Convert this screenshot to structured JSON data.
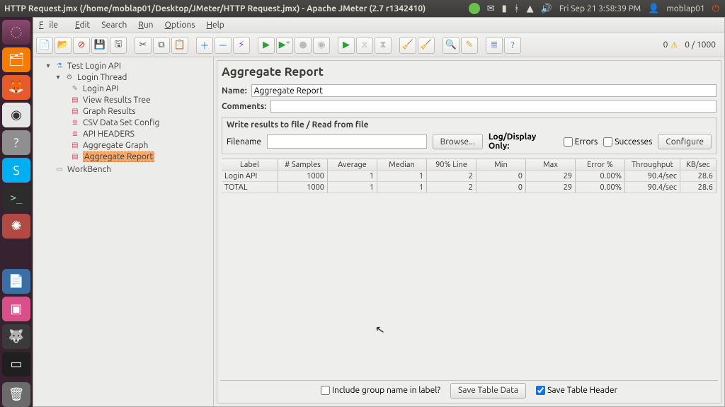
{
  "system": {
    "window_title": "HTTP Request.jmx (/home/moblap01/Desktop/JMeter/HTTP Request.jmx) - Apache JMeter (2.7 r1342410)",
    "clock": "Fri Sep 21 3:58:39 PM",
    "username": "moblap01"
  },
  "launcher": {
    "items": [
      "dash",
      "files",
      "firefox",
      "chrome",
      "help",
      "skype",
      "terminal",
      "settings",
      "writer",
      "media",
      "gimp",
      "screenshot"
    ],
    "trash": "trash"
  },
  "menubar": {
    "file": "File",
    "edit": "Edit",
    "search": "Search",
    "run": "Run",
    "options": "Options",
    "help": "Help"
  },
  "toolbar_counter": {
    "warn": "0",
    "threads": "0 / 1000"
  },
  "tree": {
    "root": "Test Login API",
    "thread": "Login Thread",
    "children": {
      "sampler": "Login API",
      "vtree": "View Results Tree",
      "graph": "Graph Results",
      "csv": "CSV Data Set Config",
      "headers": "API HEADERS",
      "agg_graph": "Aggregate Graph",
      "agg_report": "Aggregate Report"
    },
    "workbench": "WorkBench"
  },
  "panel": {
    "title": "Aggregate Report",
    "name_label": "Name:",
    "name_value": "Aggregate Report",
    "comments_label": "Comments:",
    "write_title": "Write results to file / Read from file",
    "filename_label": "Filename",
    "filename_value": "",
    "browse": "Browse...",
    "logdisplay": "Log/Display Only:",
    "errors": "Errors",
    "successes": "Successes",
    "configure": "Configure"
  },
  "table": {
    "headers": {
      "label": "Label",
      "samples": "# Samples",
      "avg": "Average",
      "median": "Median",
      "p90": "90% Line",
      "min": "Min",
      "max": "Max",
      "err": "Error %",
      "thr": "Throughput",
      "kb": "KB/sec"
    },
    "rows": [
      {
        "label": "Login API",
        "samples": "1000",
        "avg": "1",
        "median": "1",
        "p90": "2",
        "min": "0",
        "max": "29",
        "err": "0.00%",
        "thr": "90.4/sec",
        "kb": "28.6"
      },
      {
        "label": "TOTAL",
        "samples": "1000",
        "avg": "1",
        "median": "1",
        "p90": "2",
        "min": "0",
        "max": "29",
        "err": "0.00%",
        "thr": "90.4/sec",
        "kb": "28.6"
      }
    ]
  },
  "bottom": {
    "include": "Include group name in label?",
    "save_data": "Save Table Data",
    "save_header": "Save Table Header"
  }
}
